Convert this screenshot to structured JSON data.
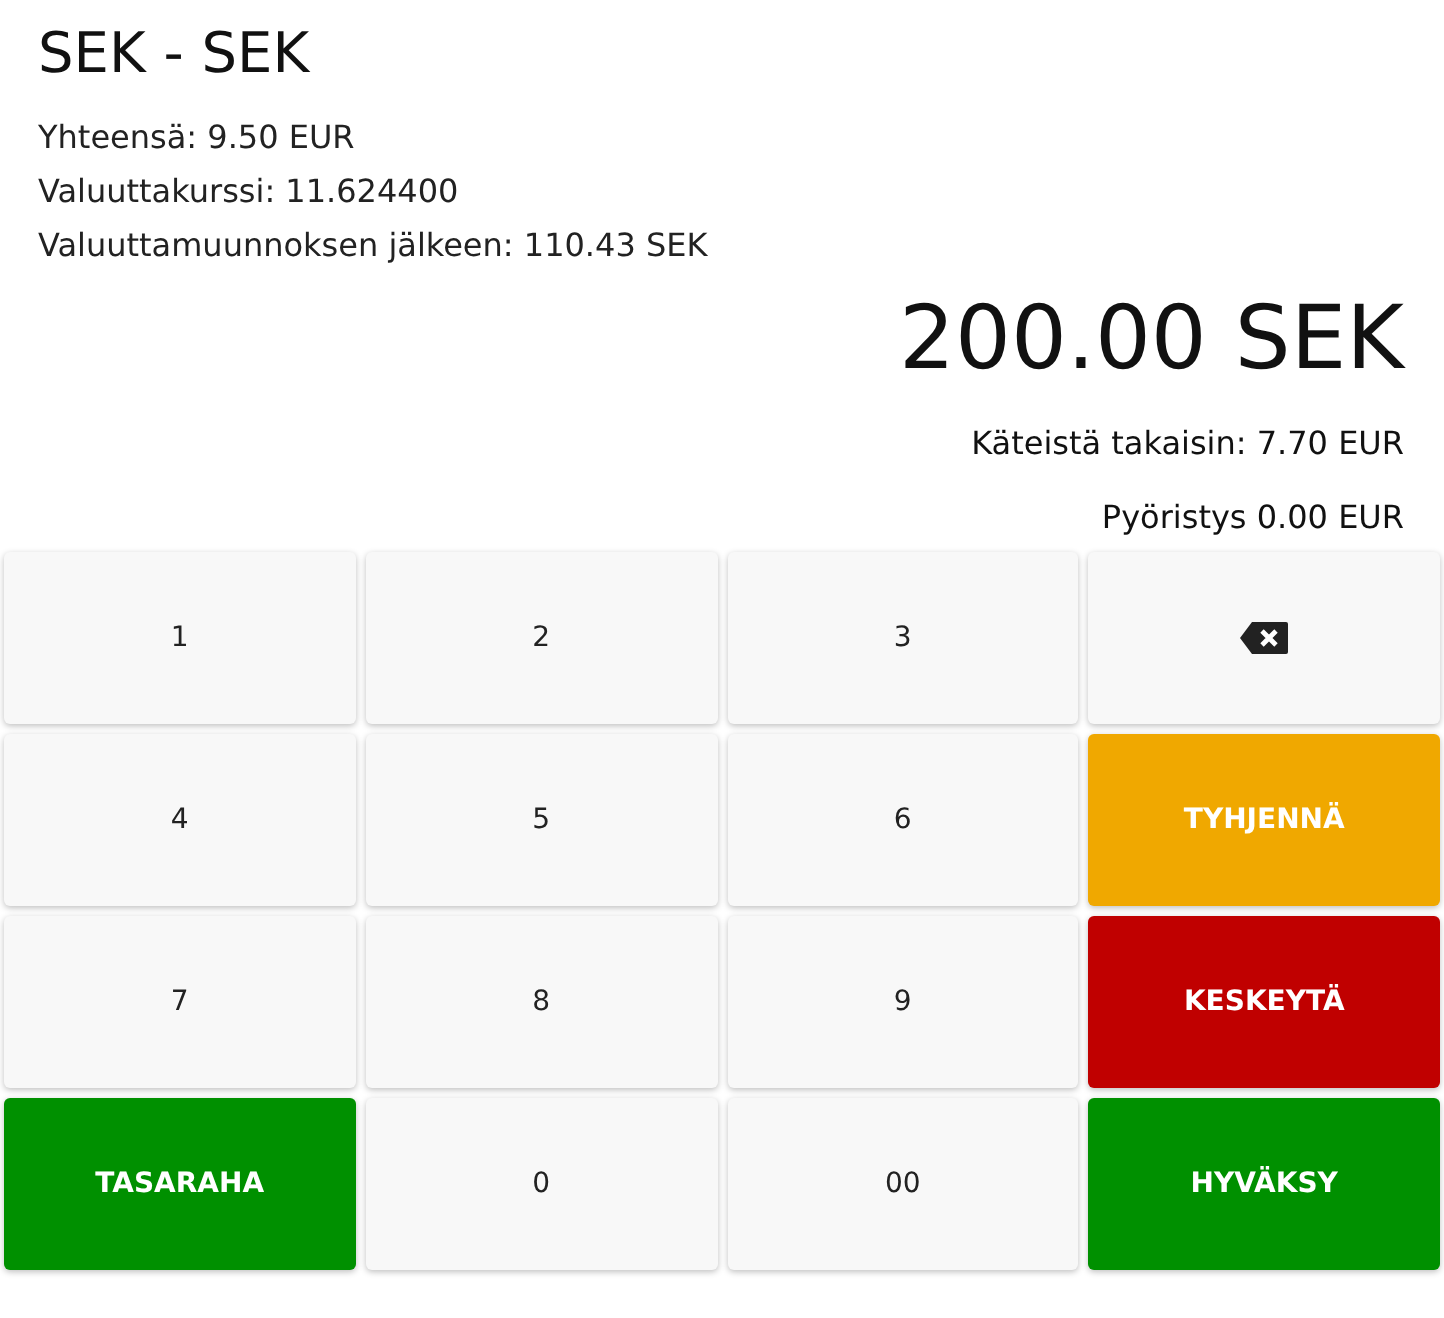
{
  "title": "SEK - SEK",
  "details": [
    "Yhteensä: 9.50 EUR",
    "Valuuttakurssi: 11.624400",
    "Valuuttamuunnoksen jälkeen: 110.43 SEK"
  ],
  "amount": "200.00 SEK",
  "change": "Käteistä takaisin: 7.70 EUR",
  "rounding": "Pyöristys 0.00 EUR",
  "keys": [
    {
      "kind": "digit",
      "label": "1"
    },
    {
      "kind": "digit",
      "label": "2"
    },
    {
      "kind": "digit",
      "label": "3"
    },
    {
      "kind": "backspace"
    },
    {
      "kind": "digit",
      "label": "4"
    },
    {
      "kind": "digit",
      "label": "5"
    },
    {
      "kind": "digit",
      "label": "6"
    },
    {
      "kind": "warning",
      "label": "TYHJENNÄ"
    },
    {
      "kind": "digit",
      "label": "7"
    },
    {
      "kind": "digit",
      "label": "8"
    },
    {
      "kind": "digit",
      "label": "9"
    },
    {
      "kind": "danger",
      "label": "KESKEYTÄ"
    },
    {
      "kind": "success",
      "label": "TASARAHA"
    },
    {
      "kind": "digit",
      "label": "0"
    },
    {
      "kind": "digit",
      "label": "00"
    },
    {
      "kind": "success",
      "label": "HYVÄKSY"
    }
  ]
}
